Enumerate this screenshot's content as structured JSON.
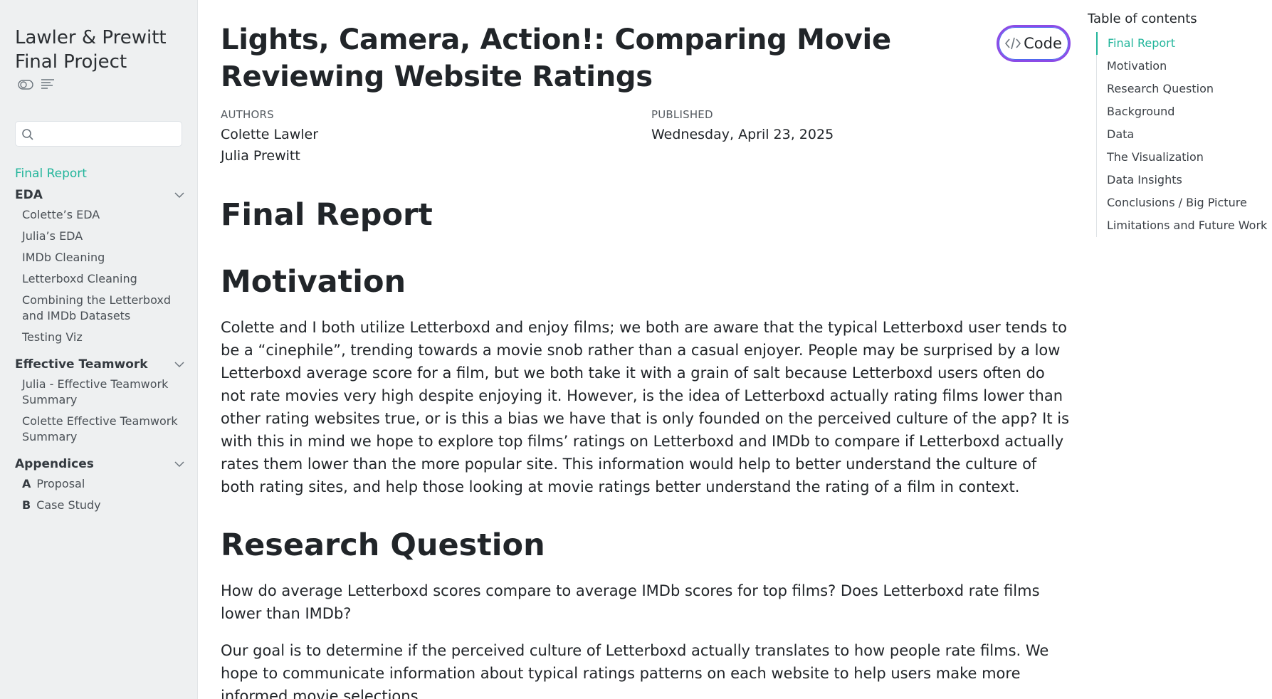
{
  "sidebar": {
    "site_title": "Lawler & Prewitt Final Project",
    "search": {
      "placeholder": "",
      "value": ""
    },
    "top_link": "Final Report",
    "sections": [
      {
        "label": "EDA",
        "items": [
          "Colette’s EDA",
          "Julia’s EDA",
          "IMDb Cleaning",
          "Letterboxd Cleaning",
          "Combining the Letterboxd and IMDb Datasets",
          "Testing Viz"
        ]
      },
      {
        "label": "Effective Teamwork",
        "items": [
          "Julia - Effective Teamwork Summary",
          "Colette Effective Teamwork Summary"
        ]
      },
      {
        "label": "Appendices",
        "items": [
          {
            "num": "A",
            "label": "Proposal"
          },
          {
            "num": "B",
            "label": "Case Study"
          }
        ]
      }
    ]
  },
  "main": {
    "title": "Lights, Camera, Action!: Comparing Movie Reviewing Website Ratings",
    "code_button": "Code",
    "authors_heading": "AUTHORS",
    "authors": [
      "Colette Lawler",
      "Julia Prewitt"
    ],
    "published_heading": "PUBLISHED",
    "published_date": "Wednesday, April 23, 2025",
    "h_final_report": "Final Report",
    "h_motivation": "Motivation",
    "motivation_text": "Colette and I both utilize Letterboxd and enjoy films; we both are aware that the typical Letterboxd user tends to be a “cinephile”, trending towards a movie snob rather than a casual enjoyer. People may be surprised by a low Letterboxd average score for a film, but we both take it with a grain of salt because Letterboxd users often do not rate movies very high despite enjoying it. However, is the idea of Letterboxd actually rating films lower than other rating websites true, or is this a bias we have that is only founded on the perceived culture of the app? It is with this in mind we hope to explore top films’ ratings on Letterboxd and IMDb to compare if Letterboxd actually rates them lower than the more popular site. This information would help to better understand the culture of both rating sites, and help those looking at movie ratings better understand the rating of a film in context.",
    "h_research": "Research Question",
    "research_text": "How do average Letterboxd scores compare to average IMDb scores for top films? Does Letterboxd rate films lower than IMDb?",
    "goal_text": "Our goal is to determine if the perceived culture of Letterboxd actually translates to how people rate films. We hope to communicate information about typical ratings patterns on each website to help users make more informed movie selections."
  },
  "toc": {
    "title": "Table of contents",
    "items": [
      "Final Report",
      "Motivation",
      "Research Question",
      "Background",
      "Data",
      "The Visualization",
      "Data Insights",
      "Conclusions / Big Picture",
      "Limitations and Future Work"
    ]
  },
  "colors": {
    "accent": "#22b59b",
    "sidebar_bg": "#eef0f1",
    "code_border": "#8b4be6"
  }
}
